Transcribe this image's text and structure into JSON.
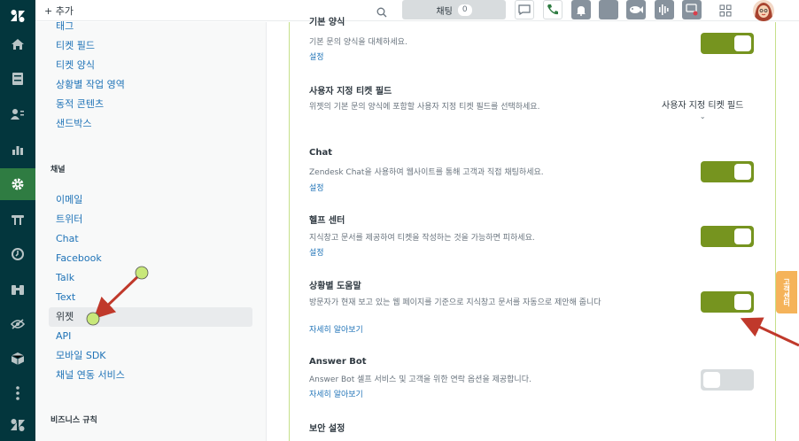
{
  "topbar": {
    "add_label": "+ 추가",
    "chat_label": "채팅",
    "chat_count": "0",
    "icons": [
      "search-icon",
      "conversation-icon",
      "phone-icon",
      "bell-icon",
      "app-icon",
      "fish-icon",
      "waveform-icon",
      "chat-notes-icon",
      "grid-icon"
    ]
  },
  "rail": {
    "icons": [
      "zendesk-logo-icon",
      "home-icon",
      "views-icon",
      "customers-icon",
      "reports-icon",
      "settings-icon",
      "channels-icon",
      "clock-icon",
      "binoculars-icon",
      "eye-icon",
      "box-icon",
      "more-icon",
      "zendesk-bottom-icon"
    ]
  },
  "sidebar": {
    "items_top": [
      "태그",
      "티켓 필드",
      "티켓 양식",
      "상황별 작업 영역",
      "동적 콘텐츠",
      "샌드박스"
    ],
    "section_channels": "채널",
    "channels": [
      "이메일",
      "트위터",
      "Chat",
      "Facebook",
      "Talk",
      "Text",
      "위젯",
      "API",
      "모바일 SDK",
      "채널 연동 서비스"
    ],
    "section_business": "비즈니스 규칙"
  },
  "main": {
    "rows": [
      {
        "title": "기본 양식",
        "desc": "기본 문의 양식을 대체하세요.",
        "link": "설정",
        "toggle": "on"
      },
      {
        "title": "사용자 지정 티켓 필드",
        "desc": "위젯의 기본 문의 양식에 포함할 사용자 지정 티켓 필드를 선택하세요.",
        "dropdown": "사용자 지정 티켓 필드"
      },
      {
        "title": "Chat",
        "desc": "Zendesk Chat을 사용하여 웹사이트를 통해 고객과 직접 채팅하세요.",
        "link": "설정",
        "toggle": "on"
      },
      {
        "title": "헬프 센터",
        "desc": "지식창고 문서를 제공하여 티켓을 작성하는 것을 가능하면 피하세요.",
        "link": "설정",
        "toggle": "on"
      },
      {
        "title": "상황별 도움말",
        "desc": "방문자가 현재 보고 있는 웹 페이지를 기준으로 지식창고 문서를 자동으로 제안해 줍니다",
        "link": "자세히 알아보기",
        "toggle": "on"
      },
      {
        "title": "Answer Bot",
        "desc": "Answer Bot 셀프 서비스 및 고객을 위한 연락 옵션을 제공합니다.",
        "link": "자세히 알아보기",
        "toggle": "off"
      },
      {
        "title": "보안 설정"
      }
    ]
  },
  "help_tab": "고객센터",
  "colors": {
    "rail": "#03363d",
    "rail_active": "#2f7c42",
    "toggle_on": "#76941f",
    "link": "#1f73b7",
    "annotation_arrow": "#c0392b",
    "annotation_dot": "#c8e87a"
  }
}
